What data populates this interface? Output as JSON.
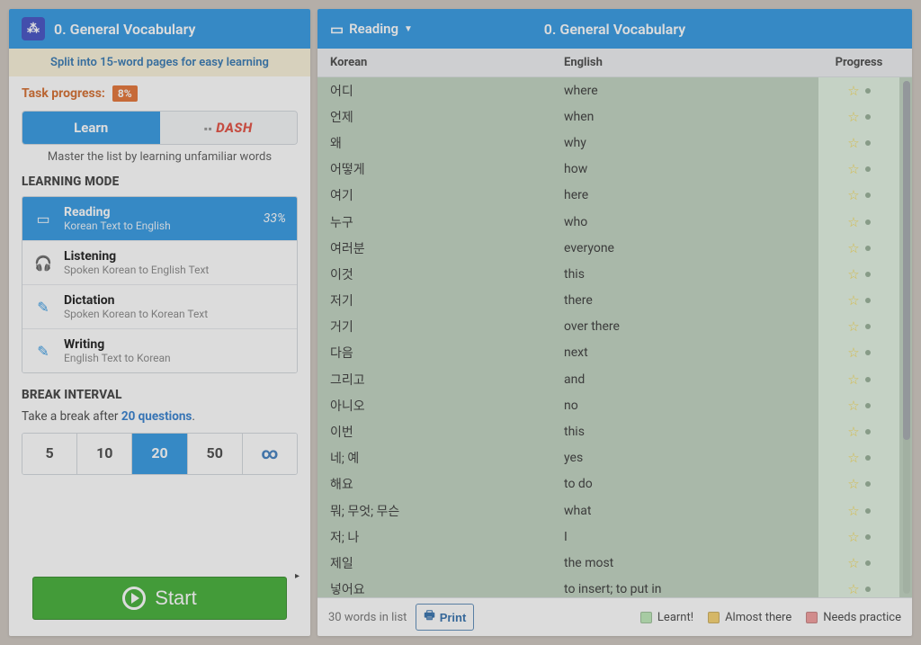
{
  "header": {
    "title": "0. General Vocabulary",
    "icon_label": "translate-icon"
  },
  "banner": "Split into 15-word pages for easy learning",
  "task_progress": {
    "label": "Task progress:",
    "value": "8%"
  },
  "learn_dash": {
    "learn": "Learn",
    "dash": "DASH",
    "subtitle": "Master the list by learning unfamiliar words"
  },
  "learning_mode": {
    "title": "LEARNING MODE",
    "modes": [
      {
        "icon": "book",
        "name": "Reading",
        "desc": "Korean Text to English",
        "pct": "33%",
        "active": true
      },
      {
        "icon": "headphones",
        "name": "Listening",
        "desc": "Spoken Korean to English Text",
        "pct": "",
        "active": false
      },
      {
        "icon": "pen-audio",
        "name": "Dictation",
        "desc": "Spoken Korean to Korean Text",
        "pct": "",
        "active": false
      },
      {
        "icon": "pen",
        "name": "Writing",
        "desc": "English Text to Korean",
        "pct": "",
        "active": false
      }
    ]
  },
  "break_interval": {
    "title": "BREAK INTERVAL",
    "text_before": "Take a break after ",
    "highlight": "20 questions",
    "text_after": ".",
    "options": [
      "5",
      "10",
      "20",
      "50",
      "∞"
    ],
    "active_index": 2
  },
  "start_label": "Start",
  "right": {
    "mode_dropdown": "Reading",
    "title": "0. General Vocabulary",
    "columns": {
      "k": "Korean",
      "e": "English",
      "p": "Progress"
    },
    "rows": [
      {
        "k": "어디",
        "e": "where"
      },
      {
        "k": "언제",
        "e": "when"
      },
      {
        "k": "왜",
        "e": "why"
      },
      {
        "k": "어떻게",
        "e": "how"
      },
      {
        "k": "여기",
        "e": "here"
      },
      {
        "k": "누구",
        "e": "who"
      },
      {
        "k": "여러분",
        "e": "everyone"
      },
      {
        "k": "이것",
        "e": "this"
      },
      {
        "k": "저기",
        "e": "there"
      },
      {
        "k": "거기",
        "e": "over there"
      },
      {
        "k": "다음",
        "e": "next"
      },
      {
        "k": "그리고",
        "e": "and"
      },
      {
        "k": "아니오",
        "e": "no"
      },
      {
        "k": "이번",
        "e": "this"
      },
      {
        "k": "네; 예",
        "e": "yes"
      },
      {
        "k": "해요",
        "e": "to do"
      },
      {
        "k": "뭐; 무엇; 무슨",
        "e": "what"
      },
      {
        "k": "저; 나",
        "e": "I"
      },
      {
        "k": "제일",
        "e": "the most"
      },
      {
        "k": "넣어요",
        "e": "to insert; to put in"
      }
    ],
    "footer": {
      "count": "30 words in list",
      "print": "Print",
      "legend": {
        "learnt": "Learnt!",
        "almost": "Almost there",
        "needs": "Needs practice"
      }
    }
  }
}
